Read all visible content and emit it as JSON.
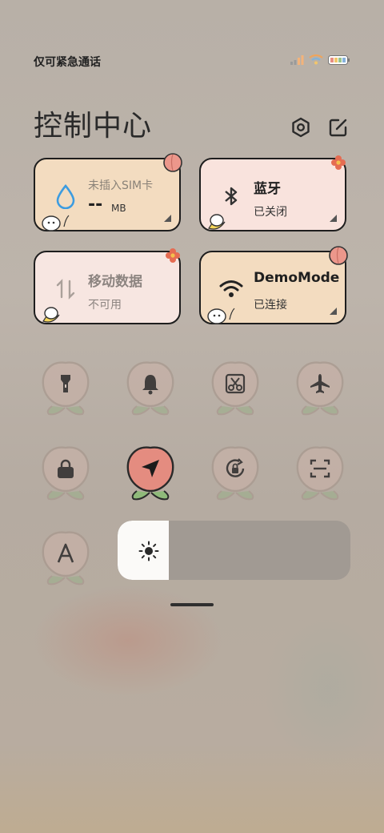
{
  "status_bar": {
    "carrier_text": "仅可紧急通话",
    "icons": [
      "signal-icon",
      "wifi-icon",
      "battery-icon"
    ]
  },
  "header": {
    "title": "控制中心",
    "settings_icon": "settings-icon",
    "edit_icon": "edit-icon"
  },
  "tiles": {
    "data_usage": {
      "label": "未插入SIM卡",
      "value": "--",
      "unit": "MB",
      "icon": "water-drop-icon"
    },
    "bluetooth": {
      "label": "蓝牙",
      "status": "已关闭",
      "icon": "bluetooth-icon"
    },
    "mobile_data": {
      "label": "移动数据",
      "status": "不可用",
      "icon": "mobile-data-icon"
    },
    "wifi": {
      "label": "DemoMode",
      "status": "已连接",
      "icon": "wifi-icon"
    }
  },
  "toggles": [
    {
      "name": "flashlight",
      "icon": "flashlight-icon",
      "active": false
    },
    {
      "name": "ring",
      "icon": "bell-icon",
      "active": false
    },
    {
      "name": "screenshot",
      "icon": "scissors-icon",
      "active": false
    },
    {
      "name": "airplane",
      "icon": "airplane-icon",
      "active": false
    },
    {
      "name": "lock",
      "icon": "lock-icon",
      "active": false
    },
    {
      "name": "location",
      "icon": "location-arrow-icon",
      "active": true
    },
    {
      "name": "rotation-lock",
      "icon": "rotation-lock-icon",
      "active": false
    },
    {
      "name": "scanner",
      "icon": "scan-icon",
      "active": false
    },
    {
      "name": "auto-brightness",
      "icon": "font-a-icon",
      "active": false
    }
  ],
  "brightness": {
    "level": 0.22,
    "icon": "sun-icon"
  },
  "colors": {
    "tile_orange": "#f3dcc0",
    "tile_pink": "#f9e3dd",
    "tile_pink_disabled": "#f7e6e1",
    "peach_inactive": "#c6b1a7",
    "peach_active": "#e48c80",
    "leaf": "#9fae8e"
  }
}
